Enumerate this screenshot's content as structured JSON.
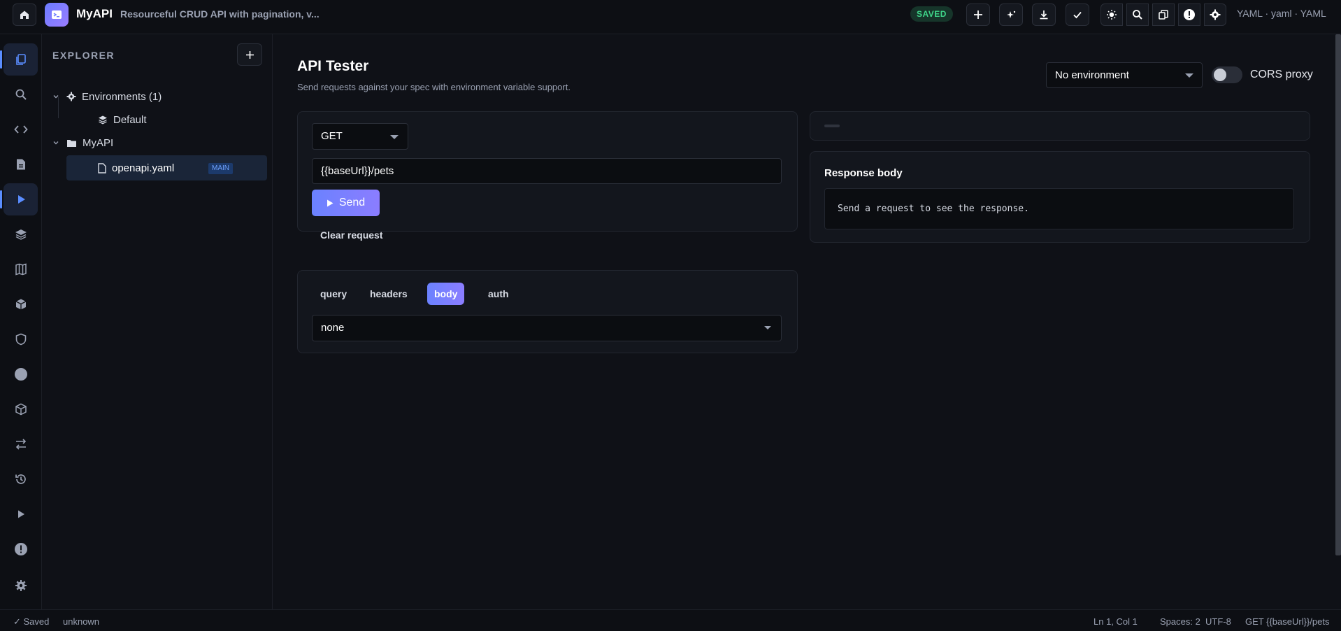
{
  "topbar": {
    "app_name": "MyAPI",
    "app_description": "Resourceful CRUD API with pagination, v...",
    "saved_badge": "SAVED",
    "format_label": "YAML · yaml · YAML"
  },
  "explorer": {
    "title": "EXPLORER",
    "environments_label": "Environments (1)",
    "environment_default": "Default",
    "project_label": "MyAPI",
    "file_name": "openapi.yaml",
    "file_tag": "MAIN"
  },
  "main": {
    "title": "API Tester",
    "subtitle": "Send requests against your spec with environment variable support.",
    "environment_select": "No environment",
    "cors_label": "CORS proxy",
    "cors_enabled": false
  },
  "request": {
    "method": "GET",
    "url": "{{baseUrl}}/pets",
    "send_label": "Send",
    "clear_label": "Clear request",
    "tabs": [
      "query",
      "headers",
      "body",
      "auth"
    ],
    "active_tab": "body",
    "body_type": "none"
  },
  "response": {
    "title": "Response body",
    "placeholder": "Send a request to see the response."
  },
  "statusbar": {
    "saved": "✓ Saved",
    "branch": "unknown",
    "position": "Ln 1, Col 1",
    "spaces": "Spaces: 2",
    "encoding": "UTF-8",
    "request_summary": "GET {{baseUrl}}/pets"
  },
  "colors": {
    "accent": "#6b82ff",
    "saved_green": "#3fd68a",
    "background": "#0f1117"
  },
  "icons": {
    "activity_bar": [
      "files-icon",
      "search-icon",
      "code-icon",
      "document-icon",
      "play-icon",
      "layers-icon",
      "map-icon",
      "package-icon",
      "shield-icon",
      "circle-icon",
      "cube-icon",
      "transfer-icon",
      "history-icon",
      "run-icon",
      "alert-icon",
      "settings-icon"
    ]
  }
}
